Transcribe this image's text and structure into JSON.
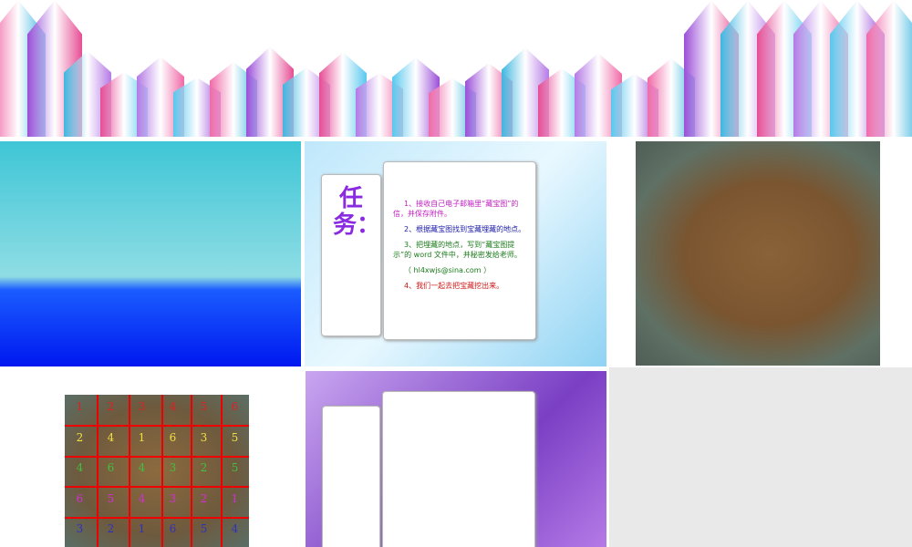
{
  "slides": [
    {
      "name": "crystal-banner"
    },
    {
      "name": "sea-horizon"
    },
    {
      "name": "task-slide",
      "title": "任务：",
      "lines": [
        {
          "text": "1、接收自己电子邮箱里“藏宝图”的信，并保存附件。",
          "color": "#c21fc2"
        },
        {
          "text": "2、根据藏宝图找到宝藏埋藏的地点。",
          "color": "#1a1aa8"
        },
        {
          "text": "3、把埋藏的地点，写到“藏宝图提示”的 word 文件中，并秘密发给老师。",
          "color": "#1a7a1a"
        },
        {
          "text": "（ hl4xwjs@sina.com ）",
          "color": "#1a7a1a"
        },
        {
          "text": "4、我们一起去把宝藏挖出来。",
          "color": "#d01818"
        }
      ]
    },
    {
      "name": "treasure-map"
    },
    {
      "name": "treasure-map-grid",
      "rows": [
        {
          "color": "#e02020",
          "nums": [
            "1",
            "2",
            "3",
            "4",
            "5",
            "6"
          ]
        },
        {
          "color": "#f0e040",
          "nums": [
            "2",
            "4",
            "1",
            "6",
            "3",
            "5"
          ]
        },
        {
          "color": "#40c040",
          "nums": [
            "4",
            "6",
            "4",
            "3",
            "2",
            "5"
          ]
        },
        {
          "color": "#d030d0",
          "nums": [
            "6",
            "5",
            "4",
            "3",
            "2",
            "1"
          ]
        },
        {
          "color": "#3030c0",
          "nums": [
            "3",
            "2",
            "1",
            "6",
            "5",
            "4"
          ]
        }
      ]
    },
    {
      "name": "stars-notebook-slide"
    }
  ]
}
